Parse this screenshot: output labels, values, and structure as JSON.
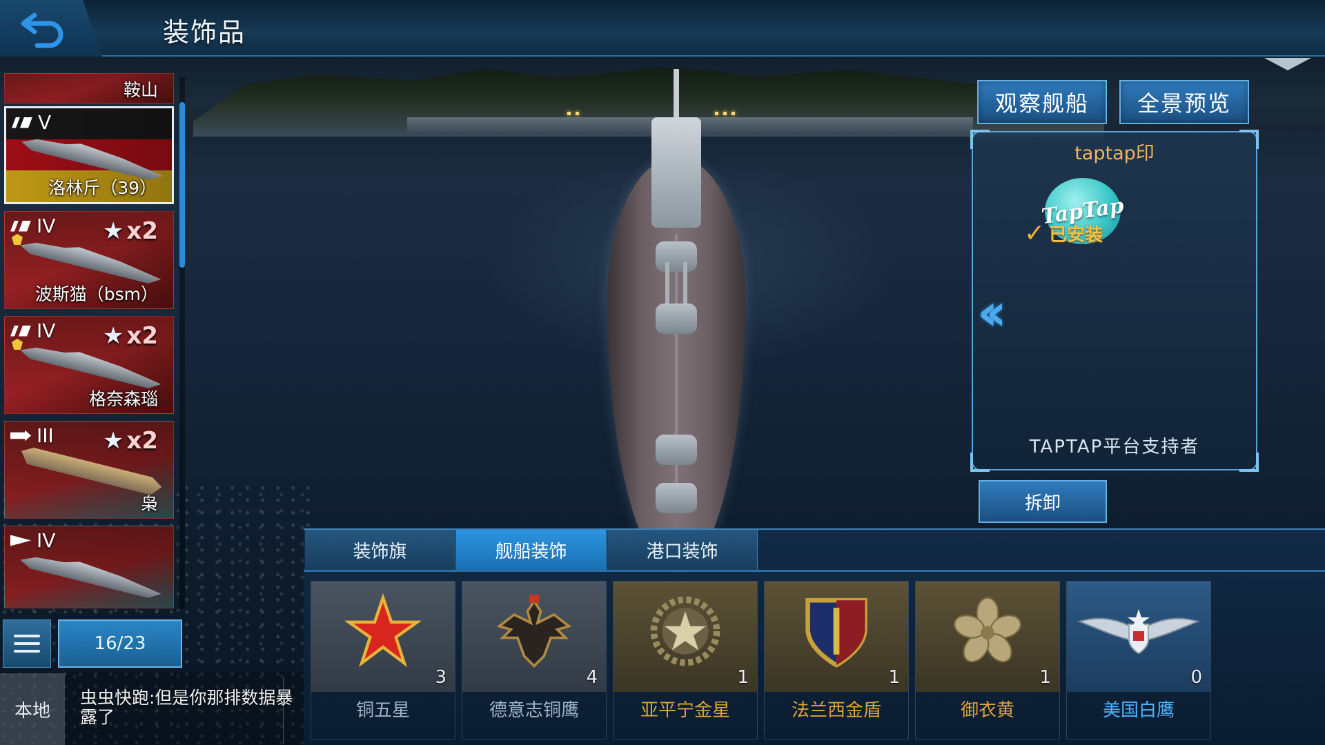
{
  "header": {
    "title": "装饰品",
    "back_icon": "back-arrow-icon"
  },
  "ship_list": {
    "items": [
      {
        "name": "鞍山",
        "tier": "",
        "type_icon": "",
        "bonus": "",
        "flag": "flag-red",
        "selected": false
      },
      {
        "name": "洛林斤（39）",
        "tier": "V",
        "type_icon": "battleship-icon",
        "bonus": "",
        "flag": "flag-de",
        "selected": true
      },
      {
        "name": "波斯猫（bsm）",
        "tier": "IV",
        "type_icon": "battleship-icon",
        "bonus": "x2",
        "flag": "flag-red",
        "selected": false
      },
      {
        "name": "格奈森瑙",
        "tier": "IV",
        "type_icon": "battleship-icon",
        "bonus": "x2",
        "flag": "flag-red",
        "selected": false
      },
      {
        "name": "枭",
        "tier": "III",
        "type_icon": "carrier-icon",
        "bonus": "x2",
        "flag": "flag-mix",
        "selected": false
      },
      {
        "name": "",
        "tier": "IV",
        "type_icon": "destroyer-icon",
        "bonus": "",
        "flag": "flag-mix",
        "selected": false
      }
    ],
    "counter": "16/23",
    "list_icon": "list-icon"
  },
  "chat": {
    "channel": "本地",
    "message": "虫虫快跑:但是你那排数据暴露了"
  },
  "actions": {
    "observe_ship": "观察舰船",
    "panorama": "全景预览",
    "unequip": "拆卸"
  },
  "detail": {
    "title": "taptap印",
    "logo_text": "TapTap",
    "status": "已安装",
    "description": "TAPTAP平台支持者",
    "nav_icon": "chevron-double-left-icon"
  },
  "tabs": [
    {
      "label": "装饰旗",
      "active": false
    },
    {
      "label": "舰船装饰",
      "active": true
    },
    {
      "label": "港口装饰",
      "active": false
    }
  ],
  "items": [
    {
      "name": "铜五星",
      "count": "3",
      "icon": "red-star-icon",
      "name_color": "#9fb6c9",
      "bg": "grey"
    },
    {
      "name": "德意志铜鹰",
      "count": "4",
      "icon": "eagle-icon",
      "name_color": "#9fb6c9",
      "bg": "grey"
    },
    {
      "name": "亚平宁金星",
      "count": "1",
      "icon": "gold-star-gear-icon",
      "name_color": "#e0a336",
      "bg": "gold"
    },
    {
      "name": "法兰西金盾",
      "count": "1",
      "icon": "gold-shield-icon",
      "name_color": "#e0a336",
      "bg": "gold"
    },
    {
      "name": "御衣黄",
      "count": "1",
      "icon": "flower-emblem-icon",
      "name_color": "#e0a336",
      "bg": "gold"
    },
    {
      "name": "美国白鹰",
      "count": "0",
      "icon": "winged-star-icon",
      "name_color": "#4fb2ff",
      "bg": "blue"
    }
  ],
  "colors": {
    "accent_blue": "#2c95e0",
    "gold_text": "#e0a336",
    "title_orange": "#f2b45c"
  }
}
